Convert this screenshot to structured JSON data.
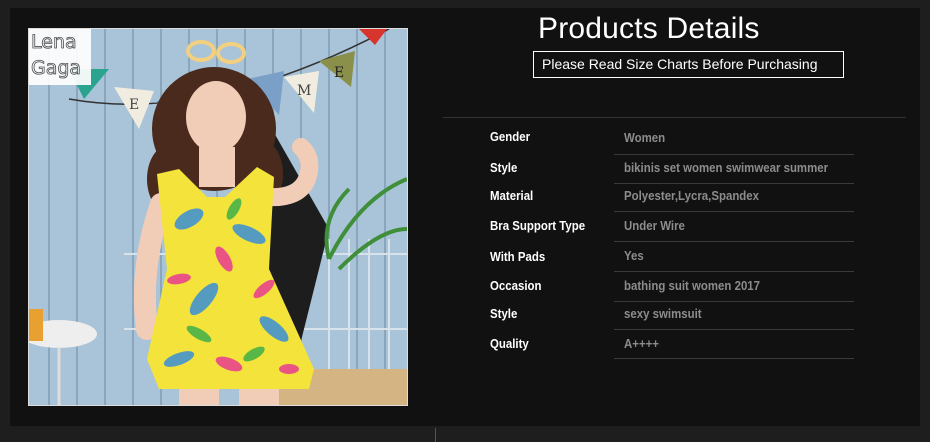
{
  "header": {
    "title": "Products Details",
    "notice": "Please Read Size Charts Before Purchasing"
  },
  "brand": {
    "logo_line1": "Lena",
    "logo_line2": "Gaga"
  },
  "image": {
    "bunting_letters": [
      "E",
      "M",
      "E"
    ]
  },
  "specs": [
    {
      "label": "Gender",
      "value": "Women"
    },
    {
      "label": "Style",
      "value": "bikinis set women swimwear summer"
    },
    {
      "label": "Material",
      "value": "Polyester,Lycra,Spandex"
    },
    {
      "label": "Bra Support Type",
      "value": "Under Wire"
    },
    {
      "label": "With Pads",
      "value": "Yes"
    },
    {
      "label": "Occasion",
      "value": "bathing suit women 2017"
    },
    {
      "label": "Style",
      "value": "sexy swimsuit"
    },
    {
      "label": "Quality",
      "value": "A++++"
    }
  ],
  "colors": {
    "background": "#111111",
    "label": "#ffffff",
    "value": "#8c8c8c"
  }
}
